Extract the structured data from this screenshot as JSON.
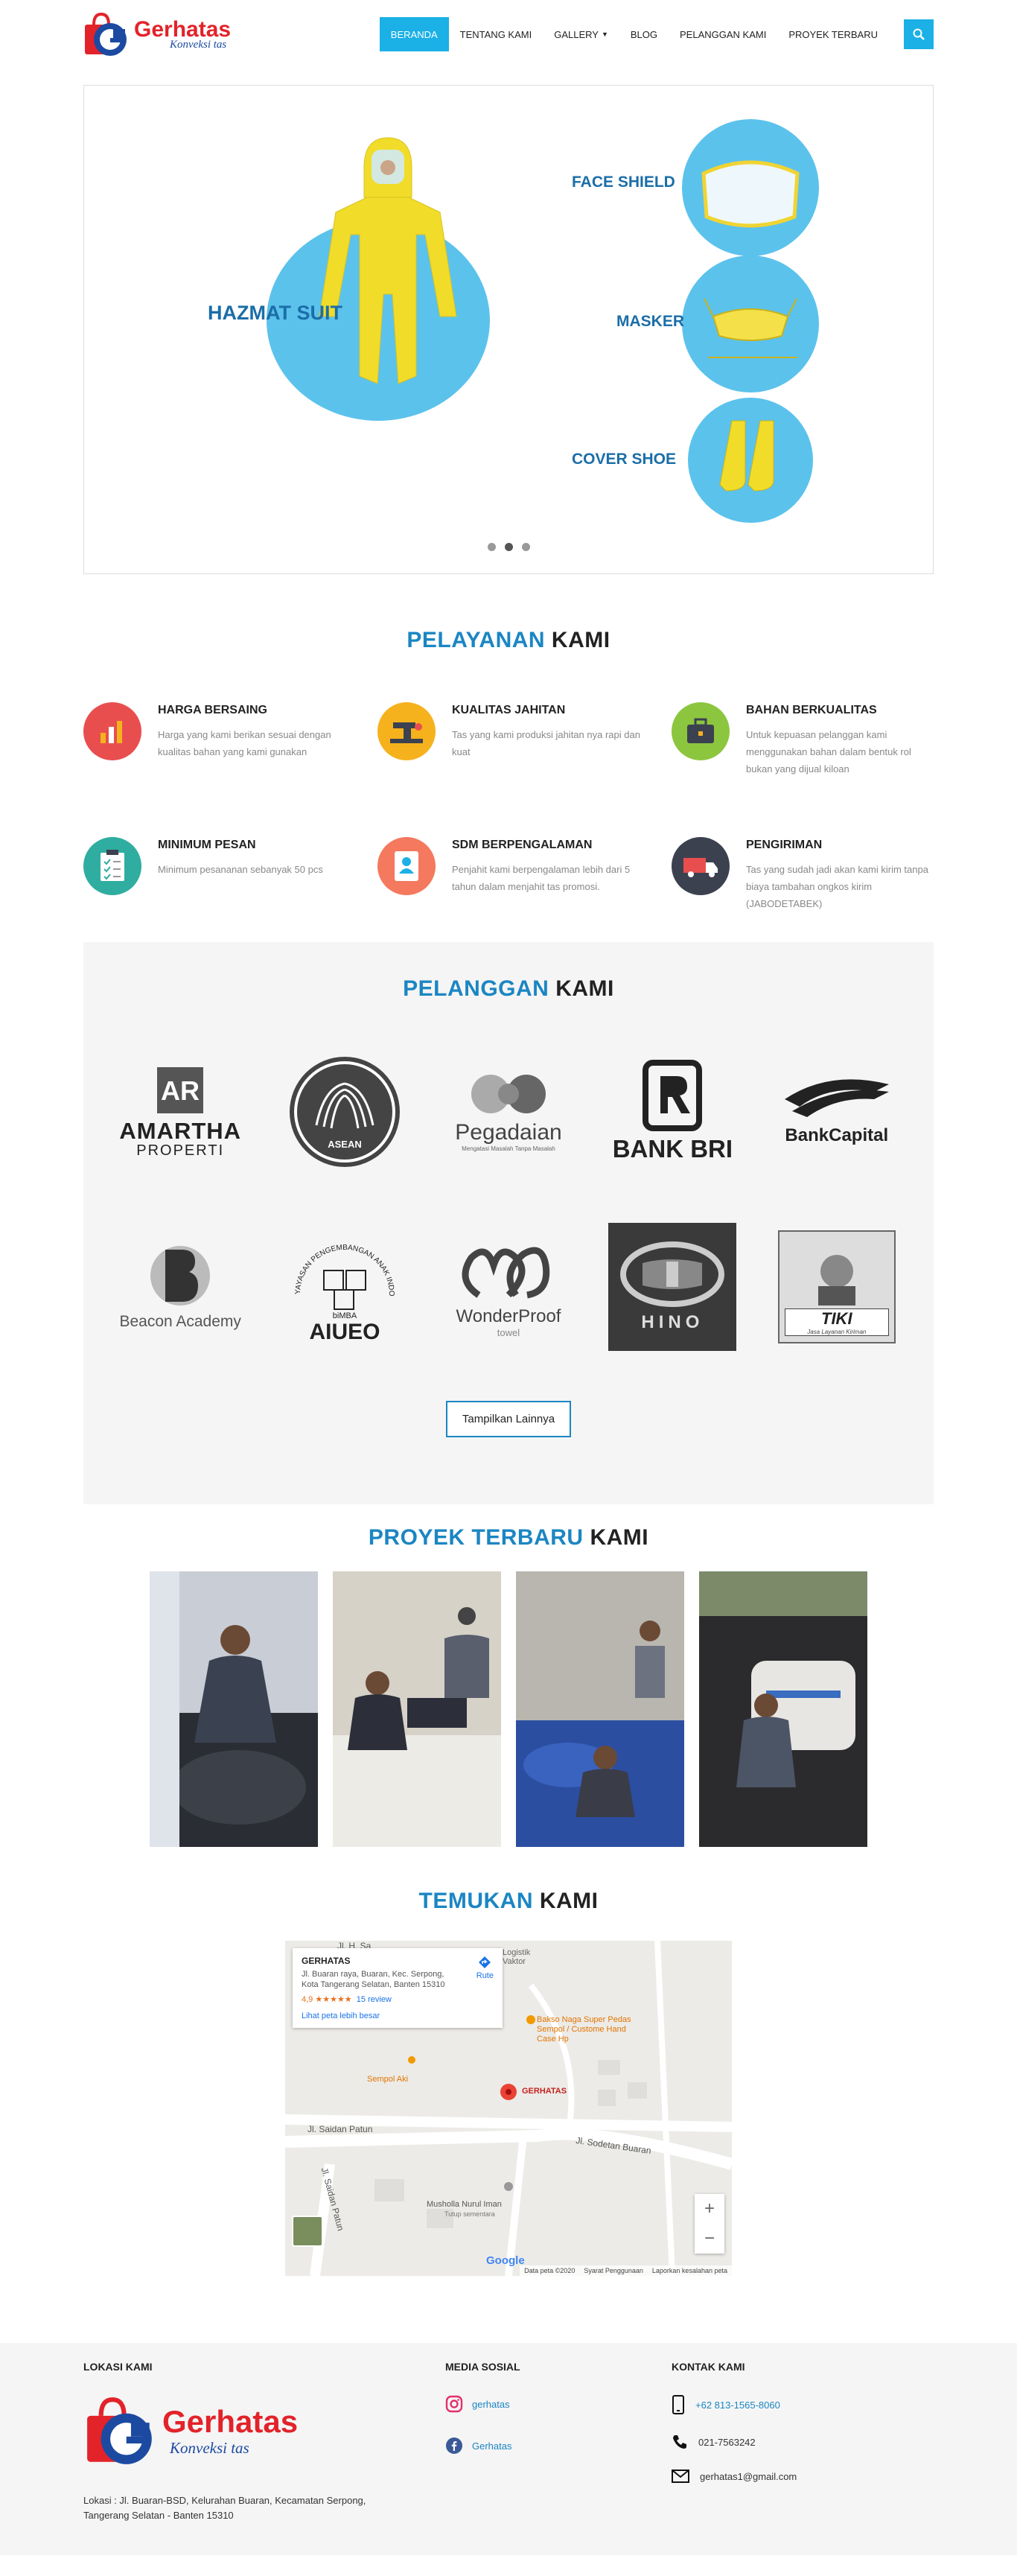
{
  "brand": {
    "name": "Gerhatas",
    "tagline": "Konveksi tas"
  },
  "nav": {
    "items": [
      {
        "label": "BERANDA",
        "active": true
      },
      {
        "label": "TENTANG KAMI"
      },
      {
        "label": "GALLERY",
        "dropdown": true
      },
      {
        "label": "BLOG"
      },
      {
        "label": "PELANGGAN KAMI"
      },
      {
        "label": "PROYEK TERBARU"
      }
    ],
    "search_icon": "search-icon",
    "accent": "#1bb0e6"
  },
  "slider": {
    "labels": {
      "hazmat": "HAZMAT SUIT",
      "face_shield": "FACE SHIELD",
      "masker": "MASKER",
      "cover_shoe": "COVER SHOE"
    },
    "dots": 3,
    "active_dot": 2
  },
  "services": {
    "title_blue": "PELAYANAN",
    "title_dark": "KAMI",
    "items": [
      {
        "title": "HARGA BERSAING",
        "text": "Harga yang kami berikan sesuai dengan kualitas bahan yang kami gunakan",
        "icon": "price-chart-icon",
        "color": "#e94e4e"
      },
      {
        "title": "KUALITAS JAHITAN",
        "text": "Tas yang kami produksi jahitan nya rapi dan kuat",
        "icon": "sewing-machine-icon",
        "color": "#f5b21d"
      },
      {
        "title": "BAHAN BERKUALITAS",
        "text": "Untuk kepuasan pelanggan kami menggunakan bahan dalam bentuk rol bukan yang dijual kiloan",
        "icon": "briefcase-icon",
        "color": "#8cc63f"
      },
      {
        "title": "MINIMUM PESAN",
        "text": "Minimum pesananan sebanyak 50 pcs",
        "icon": "checklist-icon",
        "color": "#2fada0"
      },
      {
        "title": "SDM BERPENGALAMAN",
        "text": "Penjahit kami berpengalaman lebih dari 5 tahun dalam menjahit tas promosi.",
        "icon": "profile-card-icon",
        "color": "#f4795e"
      },
      {
        "title": "PENGIRIMAN",
        "text": "Tas yang sudah jadi akan kami kirim tanpa biaya tambahan ongkos kirim (JABODETABEK)",
        "icon": "delivery-truck-icon",
        "color": "#3c4150"
      }
    ]
  },
  "clients": {
    "title_blue": "PELANGGAN",
    "title_dark": "KAMI",
    "logos": [
      {
        "name": "amartha",
        "line1": "AMARTHA",
        "line2": "PROPERTI"
      },
      {
        "name": "asean",
        "line1": "ASEAN"
      },
      {
        "name": "pegadaian",
        "line1": "Pegadaian",
        "line2": "Mengatasi Masalah Tanpa Masalah"
      },
      {
        "name": "bank-bri",
        "line1": "BANK BRI"
      },
      {
        "name": "bank-capital",
        "line1": "BankCapital"
      },
      {
        "name": "beacon",
        "line1": "Beacon Academy"
      },
      {
        "name": "bimba",
        "line1": "YAYASAN PENGEMBANGAN ANAK INDONESIA",
        "line2": "biMBA",
        "line3": "AIUEO"
      },
      {
        "name": "wonderproof",
        "line1": "WonderProof",
        "line2": "towel"
      },
      {
        "name": "hino",
        "line1": "HINO"
      },
      {
        "name": "tiki",
        "line1": "TIKI",
        "line2": "Jasa Layanan Kiriman"
      }
    ],
    "more_label": "Tampilkan Lainnya"
  },
  "projects": {
    "title_blue": "PROYEK TERBARU",
    "title_dark": "KAMI",
    "photos": [
      {
        "name": "cutting-photo"
      },
      {
        "name": "sewing-photo"
      },
      {
        "name": "packing-photo"
      },
      {
        "name": "delivery-photo"
      }
    ]
  },
  "findus": {
    "title_blue": "TEMUKAN",
    "title_dark": "KAMI",
    "map": {
      "place": "GERHATAS",
      "address": "Jl. Buaran raya, Buaran, Kec. Serpong, Kota Tangerang Selatan, Banten 15310",
      "rating": "4,9",
      "stars": "★★★★★",
      "reviews": "15 review",
      "link": "Lihat peta lebih besar",
      "directions": "Rute",
      "pin_label": "GERHATAS",
      "places": [
        "Logistik Vaktor",
        "Bakso Naga Super Pedas Sempol / Custome Hand Case Hp",
        "Sempol Aki",
        "Musholla Nurul Iman",
        "Tutup sementara"
      ],
      "streets": [
        "Jl. Saidan Patun",
        "Jl. Sodetan Buaran",
        "Jl. Saidan Patun",
        "Jl. H. Sa"
      ],
      "footer": [
        "Data peta ©2020",
        "Syarat Penggunaan",
        "Laporkan kesalahan peta"
      ],
      "google": "Google"
    }
  },
  "footer": {
    "location_title": "LOKASI KAMI",
    "address": "Lokasi : Jl. Buaran-BSD, Kelurahan Buaran, Kecamatan Serpong, Tangerang Selatan - Banten 15310",
    "social_title": "MEDIA SOSIAL",
    "social": [
      {
        "icon": "instagram-icon",
        "label": "gerhatas"
      },
      {
        "icon": "facebook-icon",
        "label": "Gerhatas"
      }
    ],
    "contact_title": "KONTAK KAMI",
    "contacts": [
      {
        "icon": "mobile-phone-icon",
        "label": "+62 813-1565-8060",
        "link": true
      },
      {
        "icon": "telephone-icon",
        "label": "021-7563242"
      },
      {
        "icon": "email-icon",
        "label": "gerhatas1@gmail.com"
      }
    ]
  }
}
